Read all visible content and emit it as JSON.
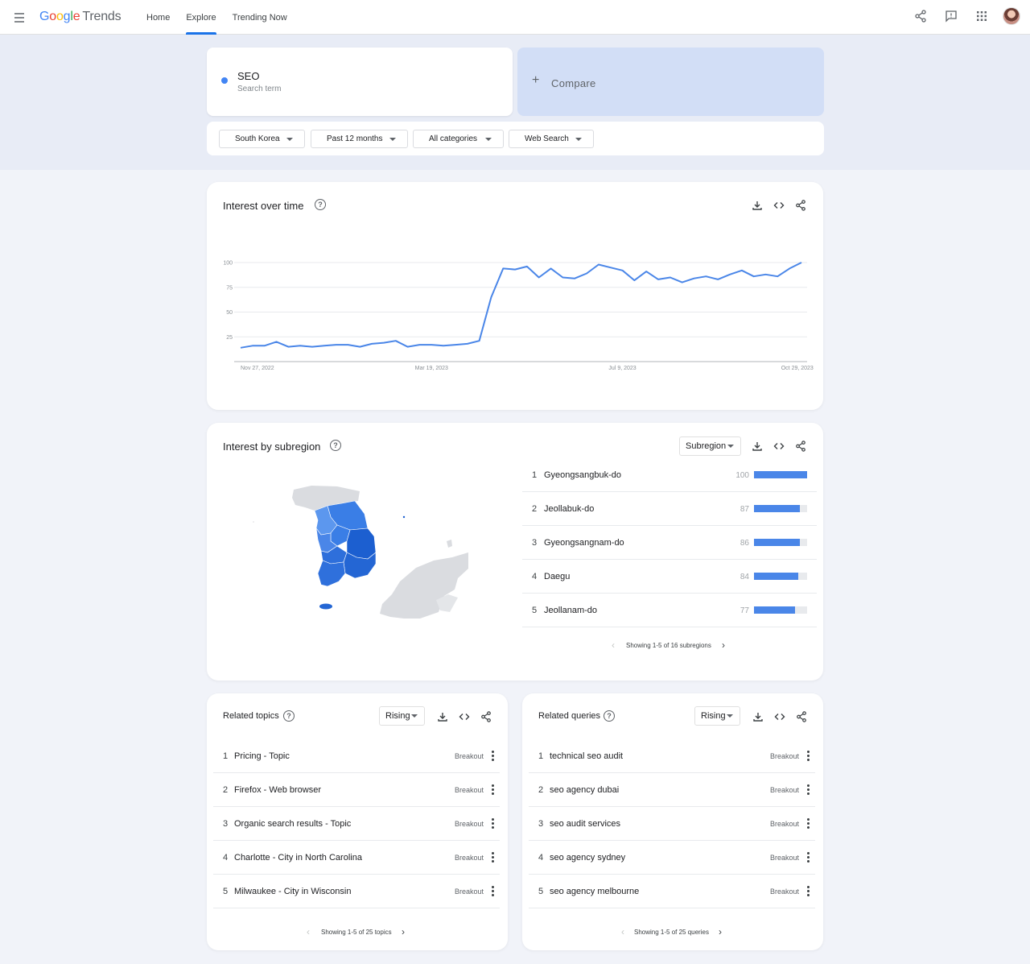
{
  "app": {
    "logo_letters": [
      "G",
      "o",
      "o",
      "g",
      "l",
      "e"
    ],
    "logo_suffix": "Trends",
    "nav": [
      {
        "label": "Home",
        "active": false
      },
      {
        "label": "Explore",
        "active": true
      },
      {
        "label": "Trending Now",
        "active": false
      }
    ],
    "top_icons": [
      "share-icon",
      "feedback-icon",
      "apps-grid-icon",
      "avatar"
    ]
  },
  "search": {
    "term": "SEO",
    "term_sublabel": "Search term",
    "term_color": "#4285f4",
    "compare_label": "Compare"
  },
  "filters": [
    {
      "label": "South Korea"
    },
    {
      "label": "Past 12 months"
    },
    {
      "label": "All categories"
    },
    {
      "label": "Web Search"
    }
  ],
  "interest_over_time": {
    "title": "Interest over time",
    "actions": [
      "download-icon",
      "embed-icon",
      "share-icon"
    ]
  },
  "chart_data": {
    "type": "line",
    "series": [
      {
        "values": [
          14,
          16,
          16,
          20,
          15,
          16,
          15,
          16,
          17,
          17,
          15,
          18,
          19,
          21,
          15,
          17,
          17,
          16,
          17,
          18,
          21,
          65,
          94,
          93,
          96,
          85,
          94,
          85,
          84,
          89,
          98,
          95,
          92,
          82,
          91,
          83,
          85,
          80,
          84,
          86,
          83,
          88,
          92,
          86,
          88,
          86,
          94,
          100
        ]
      }
    ],
    "x_tick_labels": [
      "Nov 27, 2022",
      "Mar 19, 2023",
      "Jul 9, 2023",
      "Oct 29, 2023"
    ],
    "x_tick_indices": [
      0,
      16,
      32,
      48
    ],
    "y_ticks": [
      100,
      75,
      50,
      25
    ],
    "ylim": [
      0,
      100
    ],
    "line_color": "#4a86e8",
    "grid": true
  },
  "subregion": {
    "title": "Interest by subregion",
    "select_label": "Subregion",
    "actions": [
      "download-icon",
      "embed-icon",
      "share-icon"
    ],
    "rows": [
      {
        "rank": "1",
        "name": "Gyeongsangbuk-do",
        "value": 100
      },
      {
        "rank": "2",
        "name": "Jeollabuk-do",
        "value": 87
      },
      {
        "rank": "3",
        "name": "Gyeongsangnam-do",
        "value": 86
      },
      {
        "rank": "4",
        "name": "Daegu",
        "value": 84
      },
      {
        "rank": "5",
        "name": "Jeollanam-do",
        "value": 77
      }
    ],
    "pager": "Showing 1-5 of 16 subregions",
    "map_colors": {
      "high": "#1c5fd0",
      "mid": "#3a7ee6",
      "low": "#5c97ee",
      "land": "#dadce0"
    }
  },
  "related_topics": {
    "title": "Related topics",
    "select_label": "Rising",
    "actions": [
      "download-icon",
      "embed-icon",
      "share-icon"
    ],
    "rows": [
      {
        "rank": "1",
        "name": "Pricing - Topic",
        "value": "Breakout"
      },
      {
        "rank": "2",
        "name": "Firefox - Web browser",
        "value": "Breakout"
      },
      {
        "rank": "3",
        "name": "Organic search results - Topic",
        "value": "Breakout"
      },
      {
        "rank": "4",
        "name": "Charlotte - City in North Carolina",
        "value": "Breakout"
      },
      {
        "rank": "5",
        "name": "Milwaukee - City in Wisconsin",
        "value": "Breakout"
      }
    ],
    "pager": "Showing 1-5 of 25 topics"
  },
  "related_queries": {
    "title": "Related queries",
    "select_label": "Rising",
    "actions": [
      "download-icon",
      "embed-icon",
      "share-icon"
    ],
    "rows": [
      {
        "rank": "1",
        "name": "technical seo audit",
        "value": "Breakout"
      },
      {
        "rank": "2",
        "name": "seo agency dubai",
        "value": "Breakout"
      },
      {
        "rank": "3",
        "name": "seo audit services",
        "value": "Breakout"
      },
      {
        "rank": "4",
        "name": "seo agency sydney",
        "value": "Breakout"
      },
      {
        "rank": "5",
        "name": "seo agency melbourne",
        "value": "Breakout"
      }
    ],
    "pager": "Showing 1-5 of 25 queries"
  }
}
